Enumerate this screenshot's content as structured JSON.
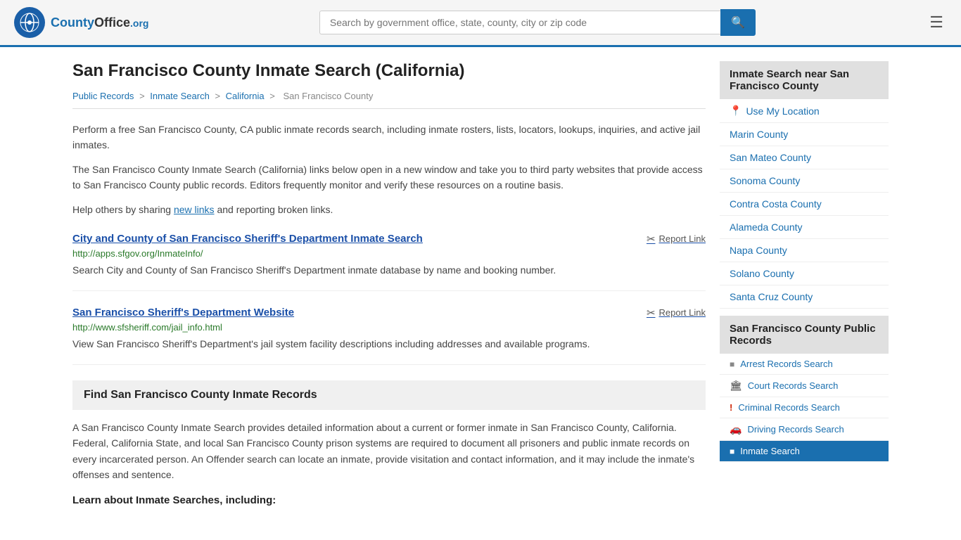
{
  "header": {
    "logo_text": "County",
    "logo_suffix": "Office",
    "logo_domain": ".org",
    "search_placeholder": "Search by government office, state, county, city or zip code",
    "search_icon": "🔍",
    "menu_icon": "☰"
  },
  "page": {
    "title": "San Francisco County Inmate Search (California)",
    "breadcrumb": {
      "items": [
        "Public Records",
        "Inmate Search",
        "California",
        "San Francisco County"
      ]
    },
    "intro1": "Perform a free San Francisco County, CA public inmate records search, including inmate rosters, lists, locators, lookups, inquiries, and active jail inmates.",
    "intro2": "The San Francisco County Inmate Search (California) links below open in a new window and take you to third party websites that provide access to San Francisco County public records. Editors frequently monitor and verify these resources on a routine basis.",
    "intro3_pre": "Help others by sharing ",
    "intro3_link": "new links",
    "intro3_post": " and reporting broken links.",
    "records": [
      {
        "title": "City and County of San Francisco Sheriff's Department Inmate Search",
        "url": "http://apps.sfgov.org/InmateInfo/",
        "desc": "Search City and County of San Francisco Sheriff's Department inmate database by name and booking number.",
        "report_label": "Report Link"
      },
      {
        "title": "San Francisco Sheriff's Department Website",
        "url": "http://www.sfsheriff.com/jail_info.html",
        "desc": "View San Francisco Sheriff's Department's jail system facility descriptions including addresses and available programs.",
        "report_label": "Report Link"
      }
    ],
    "find_section": {
      "title": "Find San Francisco County Inmate Records",
      "desc": "A San Francisco County Inmate Search provides detailed information about a current or former inmate in San Francisco County, California. Federal, California State, and local San Francisco County prison systems are required to document all prisoners and public inmate records on every incarcerated person. An Offender search can locate an inmate, provide visitation and contact information, and it may include the inmate's offenses and sentence."
    },
    "learn_title": "Learn about Inmate Searches, including:"
  },
  "sidebar": {
    "nearby_section": {
      "header": "Inmate Search near San Francisco County",
      "use_location": "Use My Location",
      "items": [
        "Marin County",
        "San Mateo County",
        "Sonoma County",
        "Contra Costa County",
        "Alameda County",
        "Napa County",
        "Solano County",
        "Santa Cruz County"
      ]
    },
    "public_records_section": {
      "header": "San Francisco County Public Records",
      "items": [
        {
          "label": "Arrest Records Search",
          "icon": "■",
          "highlighted": false
        },
        {
          "label": "Court Records Search",
          "icon": "🏛",
          "highlighted": false
        },
        {
          "label": "Criminal Records Search",
          "icon": "!",
          "highlighted": false
        },
        {
          "label": "Driving Records Search",
          "icon": "🚗",
          "highlighted": false
        },
        {
          "label": "Inmate Search",
          "icon": "■",
          "highlighted": true
        }
      ]
    }
  }
}
